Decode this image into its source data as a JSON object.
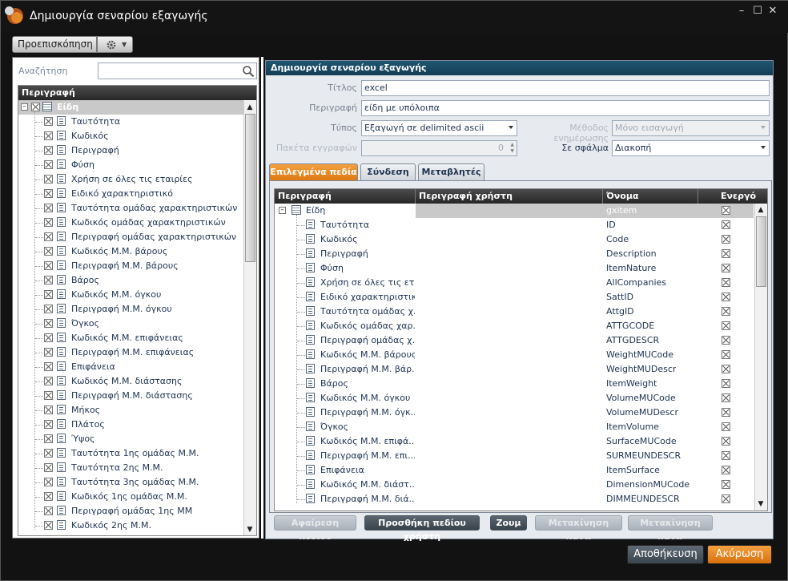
{
  "window": {
    "title": "Δημιουργία σεναρίου εξαγωγής",
    "minimize": "–",
    "maximize": "☐",
    "close": "✕"
  },
  "toolbar": {
    "preview_label": "Προεπισκόπηση",
    "settings_icon": "gear-icon"
  },
  "left": {
    "search_label": "Αναζήτηση",
    "search_value": "",
    "tree_header": "Περιγραφή",
    "root_label": "Είδη",
    "items": [
      "Ταυτότητα",
      "Κωδικός",
      "Περιγραφή",
      "Φύση",
      "Χρήση σε όλες τις εταιρίες",
      "Ειδικό χαρακτηριστικό",
      "Ταυτότητα ομάδας χαρακτηριστικών",
      "Κωδικός ομάδας χαρακτηριστικών",
      "Περιγραφή ομάδας χαρακτηριστικών",
      "Κωδικός Μ.Μ. βάρους",
      "Περιγραφή Μ.Μ. βάρους",
      "Βάρος",
      "Κωδικός Μ.Μ. όγκου",
      "Περιγραφή Μ.Μ. όγκου",
      "Όγκος",
      "Κωδικός Μ.Μ. επιφάνειας",
      "Περιγραφή Μ.Μ. επιφάνειας",
      "Επιφάνεια",
      "Κωδικός Μ.Μ. διάστασης",
      "Περιγραφή Μ.Μ. διάστασης",
      "Μήκος",
      "Πλάτος",
      "Ύψος",
      "Ταυτότητα 1ης ομάδας Μ.Μ.",
      "Ταυτότητα 2ης Μ.Μ.",
      "Ταυτότητα 3ης ομάδας Μ.Μ.",
      "Κωδικός 1ης ομάδας Μ.Μ.",
      "Περιγραφή ομάδας 1ης ΜΜ",
      "Κωδικός 2ης Μ.Μ."
    ]
  },
  "right": {
    "panel_title": "Δημιουργία σεναρίου εξαγωγής",
    "fields": {
      "title_label": "Τίτλος",
      "title_value": "excel",
      "desc_label": "Περιγραφή",
      "desc_value": "είδη με υπόλοιπα",
      "type_label": "Τύπος",
      "type_value": "Εξαγωγή σε delimited ascii",
      "update_method_label": "Μέθοδος ενημέρωσης",
      "update_method_value": "Μόνο εισαγωγή",
      "packets_label": "Πακέτα εγγραφών",
      "packets_value": "0",
      "on_error_label": "Σε σφάλμα",
      "on_error_value": "Διακοπή"
    },
    "tabs": [
      "Επιλεγμένα πεδία",
      "Σύνδεση",
      "Μεταβλητές"
    ],
    "grid": {
      "headers": [
        "Περιγραφή",
        "Περιγραφή χρήστη",
        "Όνομα",
        "Ενεργό"
      ],
      "root": {
        "desc": "Είδη",
        "name": "gxitem"
      },
      "rows": [
        {
          "desc": "Ταυτότητα",
          "name": "ID"
        },
        {
          "desc": "Κωδικός",
          "name": "Code"
        },
        {
          "desc": "Περιγραφή",
          "name": "Description"
        },
        {
          "desc": "Φύση",
          "name": "ItemNature"
        },
        {
          "desc": "Χρήση σε όλες τις ετα...",
          "name": "AllCompanies"
        },
        {
          "desc": "Ειδικό χαρακτηριστικό",
          "name": "SattID"
        },
        {
          "desc": "Ταυτότητα ομάδας χ...",
          "name": "AttgID"
        },
        {
          "desc": "Κωδικός ομάδας χαρ...",
          "name": "ATTGCODE"
        },
        {
          "desc": "Περιγραφή ομάδας χ...",
          "name": "ATTGDESCR"
        },
        {
          "desc": "Κωδικός Μ.Μ. βάρους",
          "name": "WeightMUCode"
        },
        {
          "desc": "Περιγραφή Μ.Μ. βάρ...",
          "name": "WeightMUDescr"
        },
        {
          "desc": "Βάρος",
          "name": "ItemWeight"
        },
        {
          "desc": "Κωδικός Μ.Μ. όγκου",
          "name": "VolumeMUCode"
        },
        {
          "desc": "Περιγραφή Μ.Μ. όγκ...",
          "name": "VolumeMUDescr"
        },
        {
          "desc": "Όγκος",
          "name": "ItemVolume"
        },
        {
          "desc": "Κωδικός Μ.Μ. επιφά...",
          "name": "SurfaceMUCode"
        },
        {
          "desc": "Περιγραφή Μ.Μ. επι...",
          "name": "SURMEUNDESCR"
        },
        {
          "desc": "Επιφάνεια",
          "name": "ItemSurface"
        },
        {
          "desc": "Κωδικός Μ.Μ. διάστ...",
          "name": "DimensionMUCode"
        },
        {
          "desc": "Περιγραφή Μ.Μ. διά...",
          "name": "DIMMEUNDESCR"
        }
      ]
    },
    "buttons": {
      "remove_field": "Αφαίρεση πεδίου",
      "add_user_field": "Προσθήκη πεδίου χρήστη",
      "zoom": "Ζουμ",
      "move_up": "Μετακίνηση πάνω",
      "move_down": "Μετακίνηση κάτω"
    }
  },
  "footer": {
    "save": "Αποθήκευση",
    "cancel": "Ακύρωση"
  },
  "colors": {
    "accent": "#de7a14",
    "header_dark": "#133e55"
  }
}
